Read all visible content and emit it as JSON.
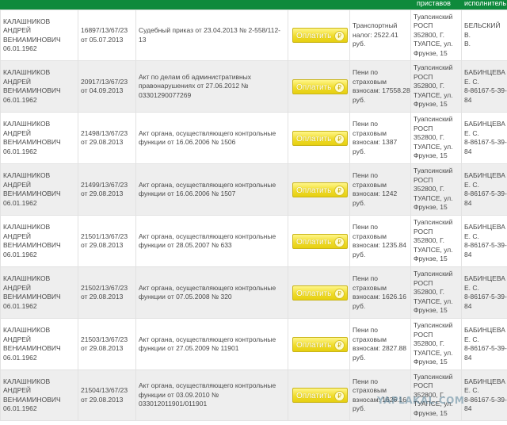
{
  "header": {
    "bailiffs": "приставов",
    "executor": "исполнитель"
  },
  "pay_label": "Оплатить",
  "currency_glyph": "₽",
  "colors": {
    "header_green": "#0e8a3c",
    "pay_button": "#f0dc2a",
    "row_alt": "#eeeeee"
  },
  "watermark": "YAPLAKAL.COM",
  "rows": [
    {
      "debtor": [
        "КАЛАШНИКОВ",
        "АНДРЕЙ",
        "ВЕНИАМИНОВИЧ",
        "06.01.1962"
      ],
      "proceeding": [
        "16897/13/67/23",
        "от 05.07.2013"
      ],
      "document": [
        "Судебный приказ от 23.04.2013 № 2-558/112-13"
      ],
      "subject": [
        "Транспортный",
        "налог: 2522.41 руб."
      ],
      "department": [
        "Туапсинский",
        "РОСП",
        "352800, Г.",
        "ТУАПСЕ, ул.",
        "Фрунзе, 15"
      ],
      "bailiff": [
        "БЕЛЬСКИЙ В.",
        "В."
      ]
    },
    {
      "debtor": [
        "КАЛАШНИКОВ",
        "АНДРЕЙ",
        "ВЕНИАМИНОВИЧ",
        "06.01.1962"
      ],
      "proceeding": [
        "20917/13/67/23",
        "от 04.09.2013"
      ],
      "document": [
        "Акт по делам об административных",
        "правонарушениях от 27.06.2012 №",
        "03301290077269"
      ],
      "subject": [
        "Пени по",
        "страховым",
        "взносам: 17558.28",
        "руб."
      ],
      "department": [
        "Туапсинский",
        "РОСП",
        "352800, Г.",
        "ТУАПСЕ, ул.",
        "Фрунзе, 15"
      ],
      "bailiff": [
        "БАБИНЦЕВА",
        "Е. С.",
        "8-86167-5-39-",
        "84"
      ]
    },
    {
      "debtor": [
        "КАЛАШНИКОВ",
        "АНДРЕЙ",
        "ВЕНИАМИНОВИЧ",
        "06.01.1962"
      ],
      "proceeding": [
        "21498/13/67/23",
        "от 29.08.2013"
      ],
      "document": [
        "Акт органа, осуществляющего контрольные",
        "функции от 16.06.2006 № 1506"
      ],
      "subject": [
        "Пени по",
        "страховым",
        "взносам: 1387 руб."
      ],
      "department": [
        "Туапсинский",
        "РОСП",
        "352800, Г.",
        "ТУАПСЕ, ул.",
        "Фрунзе, 15"
      ],
      "bailiff": [
        "БАБИНЦЕВА",
        "Е. С.",
        "8-86167-5-39-",
        "84"
      ]
    },
    {
      "debtor": [
        "КАЛАШНИКОВ",
        "АНДРЕЙ",
        "ВЕНИАМИНОВИЧ",
        "06.01.1962"
      ],
      "proceeding": [
        "21499/13/67/23",
        "от 29.08.2013"
      ],
      "document": [
        "Акт органа, осуществляющего контрольные",
        "функции от 16.06.2006 № 1507"
      ],
      "subject": [
        "Пени по",
        "страховым",
        "взносам: 1242 руб."
      ],
      "department": [
        "Туапсинский",
        "РОСП",
        "352800, Г.",
        "ТУАПСЕ, ул.",
        "Фрунзе, 15"
      ],
      "bailiff": [
        "БАБИНЦЕВА",
        "Е. С.",
        "8-86167-5-39-",
        "84"
      ]
    },
    {
      "debtor": [
        "КАЛАШНИКОВ",
        "АНДРЕЙ",
        "ВЕНИАМИНОВИЧ",
        "06.01.1962"
      ],
      "proceeding": [
        "21501/13/67/23",
        "от 29.08.2013"
      ],
      "document": [
        "Акт органа, осуществляющего контрольные",
        "функции от 28.05.2007 № 633"
      ],
      "subject": [
        "Пени по",
        "страховым",
        "взносам: 1235.84",
        "руб."
      ],
      "department": [
        "Туапсинский",
        "РОСП",
        "352800, Г.",
        "ТУАПСЕ, ул.",
        "Фрунзе, 15"
      ],
      "bailiff": [
        "БАБИНЦЕВА",
        "Е. С.",
        "8-86167-5-39-",
        "84"
      ]
    },
    {
      "debtor": [
        "КАЛАШНИКОВ",
        "АНДРЕЙ",
        "ВЕНИАМИНОВИЧ",
        "06.01.1962"
      ],
      "proceeding": [
        "21502/13/67/23",
        "от 29.08.2013"
      ],
      "document": [
        "Акт органа, осуществляющего контрольные",
        "функции от 07.05.2008 № 320"
      ],
      "subject": [
        "Пени по",
        "страховым",
        "взносам: 1626.16",
        "руб."
      ],
      "department": [
        "Туапсинский",
        "РОСП",
        "352800, Г.",
        "ТУАПСЕ, ул.",
        "Фрунзе, 15"
      ],
      "bailiff": [
        "БАБИНЦЕВА",
        "Е. С.",
        "8-86167-5-39-",
        "84"
      ]
    },
    {
      "debtor": [
        "КАЛАШНИКОВ",
        "АНДРЕЙ",
        "ВЕНИАМИНОВИЧ",
        "06.01.1962"
      ],
      "proceeding": [
        "21503/13/67/23",
        "от 29.08.2013"
      ],
      "document": [
        "Акт органа, осуществляющего контрольные",
        "функции от 27.05.2009 № 11901"
      ],
      "subject": [
        "Пени по",
        "страховым",
        "взносам: 2827.88",
        "руб."
      ],
      "department": [
        "Туапсинский",
        "РОСП",
        "352800, Г.",
        "ТУАПСЕ, ул.",
        "Фрунзе, 15"
      ],
      "bailiff": [
        "БАБИНЦЕВА",
        "Е. С.",
        "8-86167-5-39-",
        "84"
      ]
    },
    {
      "debtor": [
        "КАЛАШНИКОВ",
        "АНДРЕЙ",
        "ВЕНИАМИНОВИЧ",
        "06.01.1962"
      ],
      "proceeding": [
        "21504/13/67/23",
        "от 29.08.2013"
      ],
      "document": [
        "Акт органа, осуществляющего контрольные",
        "функции от 03.09.2010 № 033012011901/011901"
      ],
      "subject": [
        "Пени по",
        "страховым",
        "взносам: 1626.16",
        "руб."
      ],
      "department": [
        "Туапсинский",
        "РОСП",
        "352800, Г.",
        "ТУАПСЕ, ул.",
        "Фрунзе, 15"
      ],
      "bailiff": [
        "БАБИНЦЕВА",
        "Е. С.",
        "8-86167-5-39-",
        "84"
      ]
    }
  ]
}
